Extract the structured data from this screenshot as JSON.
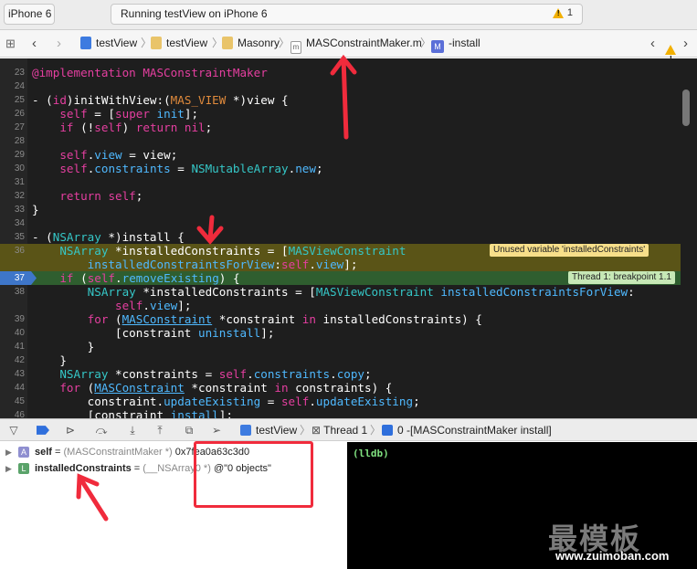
{
  "toolbar": {
    "scheme": "iPhone 6",
    "status": "Running testView on iPhone 6",
    "warning_count": "1",
    "warning_icon": "warning-triangle-icon"
  },
  "jumpbar": {
    "crumbs": [
      "testView",
      "testView",
      "Masonry",
      "MASConstraintMaker.m",
      "-install"
    ],
    "file_badge": "m",
    "method_badge": "M"
  },
  "editor": {
    "lines": [
      {
        "num": "23",
        "code": "@implementation MASConstraintMaker"
      },
      {
        "num": "24",
        "code": ""
      },
      {
        "num": "25",
        "code": "- (id)initWithView:(MAS_VIEW *)view {"
      },
      {
        "num": "26",
        "code": "    self = [super init];"
      },
      {
        "num": "27",
        "code": "    if (!self) return nil;"
      },
      {
        "num": "28",
        "code": ""
      },
      {
        "num": "29",
        "code": "    self.view = view;"
      },
      {
        "num": "30",
        "code": "    self.constraints = NSMutableArray.new;"
      },
      {
        "num": "31",
        "code": ""
      },
      {
        "num": "32",
        "code": "    return self;"
      },
      {
        "num": "33",
        "code": "}"
      },
      {
        "num": "34",
        "code": ""
      },
      {
        "num": "35",
        "code": "- (NSArray *)install {"
      },
      {
        "num": "36",
        "code": "    NSArray *installedConstraints = [MASViewConstraint"
      },
      {
        "num": "",
        "code": "        installedConstraintsForView:self.view];"
      },
      {
        "num": "37",
        "code": "    if (self.removeExisting) {"
      },
      {
        "num": "38",
        "code": "        NSArray *installedConstraints = [MASViewConstraint installedConstraintsForView:"
      },
      {
        "num": "",
        "code": "            self.view];"
      },
      {
        "num": "39",
        "code": "        for (MASConstraint *constraint in installedConstraints) {"
      },
      {
        "num": "40",
        "code": "            [constraint uninstall];"
      },
      {
        "num": "41",
        "code": "        }"
      },
      {
        "num": "42",
        "code": "    }"
      },
      {
        "num": "43",
        "code": "    NSArray *constraints = self.constraints.copy;"
      },
      {
        "num": "44",
        "code": "    for (MASConstraint *constraint in constraints) {"
      },
      {
        "num": "45",
        "code": "        constraint.updateExisting = self.updateExisting;"
      },
      {
        "num": "46",
        "code": "        [constraint install];"
      }
    ],
    "warning_note": "Unused variable 'installedConstraints'",
    "breakpoint_note": "Thread 1: breakpoint 1.1"
  },
  "debugbar": {
    "target": "testView",
    "thread": "Thread 1",
    "frame": "0 -[MASConstraintMaker install]"
  },
  "variables": [
    {
      "badge": "A",
      "name": "self",
      "type": "(MASConstraintMaker *)",
      "value": "0x7fea0a63c3d0"
    },
    {
      "badge": "L",
      "name": "installedConstraints",
      "type": "(__NSArray0 *)",
      "value": "@\"0 objects\""
    }
  ],
  "console": {
    "prompt": "(lldb)"
  },
  "watermark": {
    "brand": "最模板",
    "url": "www.zuimoban.com"
  },
  "colors": {
    "annotation": "#f02b3c",
    "warning": "#5a5417",
    "breakpoint": "#2f5e2f",
    "keyword": "#e53fa0",
    "class": "#35c7c7",
    "method": "#4fb9ff"
  }
}
